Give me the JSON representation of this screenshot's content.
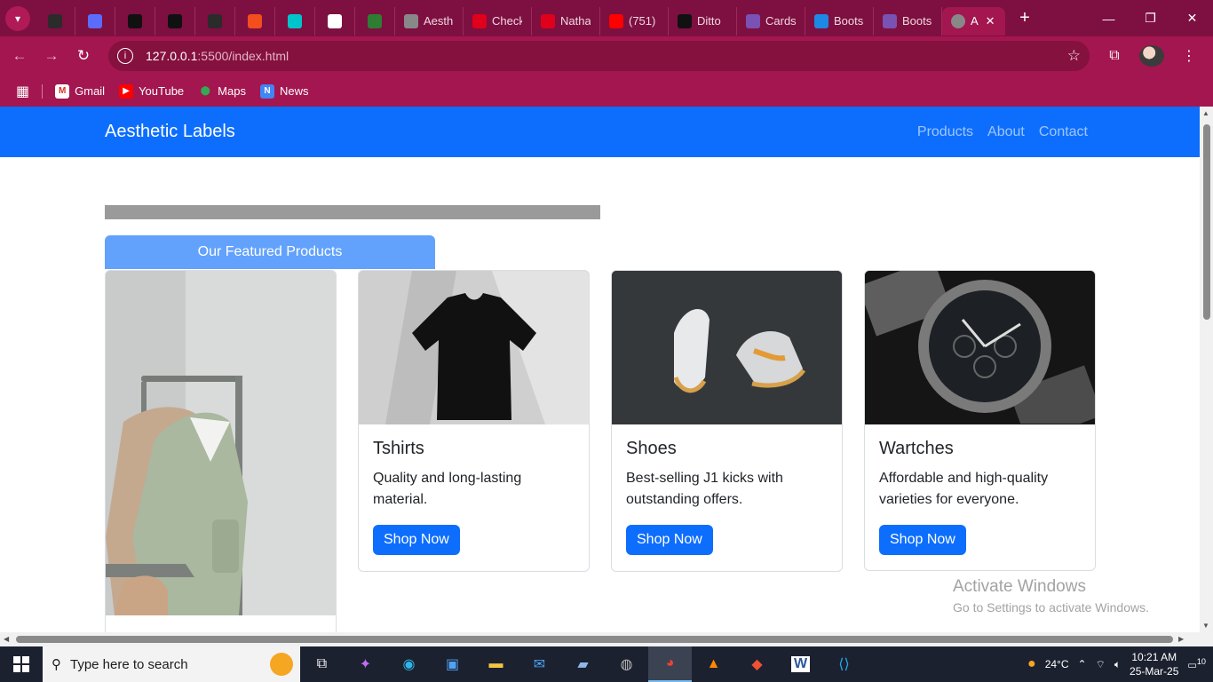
{
  "browser": {
    "tabs": [
      {
        "label": "",
        "icon": "github-icon",
        "color": "#2b2b2b"
      },
      {
        "label": "",
        "icon": "play-icon",
        "color": "#5b6cff"
      },
      {
        "label": "",
        "icon": "cursor-icon",
        "color": "#111111"
      },
      {
        "label": "",
        "icon": "openai-icon",
        "color": "#111111"
      },
      {
        "label": "",
        "icon": "github-icon",
        "color": "#2b2b2b"
      },
      {
        "label": "",
        "icon": "figma-icon",
        "color": "#f24e1e"
      },
      {
        "label": "",
        "icon": "canva-icon",
        "color": "#00c4cc"
      },
      {
        "label": "",
        "icon": "notion-icon",
        "color": "#ffffff"
      },
      {
        "label": "",
        "icon": "webflow-icon",
        "color": "#2e7d32"
      },
      {
        "label": "Aesth",
        "icon": "globe-icon",
        "color": "#888888"
      },
      {
        "label": "Check",
        "icon": "opera-icon",
        "color": "#e0001b"
      },
      {
        "label": "Natha",
        "icon": "opera-icon",
        "color": "#e0001b"
      },
      {
        "label": "(751)",
        "icon": "youtube-icon",
        "color": "#ff0000"
      },
      {
        "label": "Ditto",
        "icon": "ditto-icon",
        "color": "#111111"
      },
      {
        "label": "Cards",
        "icon": "bootstrap-icon",
        "color": "#7952b3"
      },
      {
        "label": "Boots",
        "icon": "bolt-icon",
        "color": "#1e88e5"
      },
      {
        "label": "Boots",
        "icon": "bootstrap-icon",
        "color": "#7952b3"
      }
    ],
    "active_tab": {
      "label": "A",
      "icon": "globe-icon"
    },
    "url_host": "127.0.0.1",
    "url_path": ":5500/index.html",
    "bookmarks": [
      {
        "label": "Gmail",
        "icon": "gmail-icon"
      },
      {
        "label": "YouTube",
        "icon": "youtube-icon"
      },
      {
        "label": "Maps",
        "icon": "maps-icon"
      },
      {
        "label": "News",
        "icon": "news-icon"
      }
    ]
  },
  "page": {
    "brand": "Aesthetic Labels",
    "nav": [
      "Products",
      "About",
      "Contact"
    ],
    "featured_label": "Our Featured Products",
    "cards": [
      {
        "title": "Tshirts",
        "text": "Quality and long-lasting material.",
        "button": "Shop Now"
      },
      {
        "title": "Shoes",
        "text": "Best-selling J1 kicks with outstanding offers.",
        "button": "Shop Now"
      },
      {
        "title": "Wartches",
        "text": "Affordable and high-quality varieties for everyone.",
        "button": "Shop Now"
      }
    ],
    "accent": "#0d6efd"
  },
  "watermark": {
    "line1": "Activate Windows",
    "line2": "Go to Settings to activate Windows."
  },
  "taskbar": {
    "search_placeholder": "Type here to search",
    "weather": "24°C",
    "time": "10:21 AM",
    "date": "25-Mar-25",
    "notifications": "10"
  }
}
